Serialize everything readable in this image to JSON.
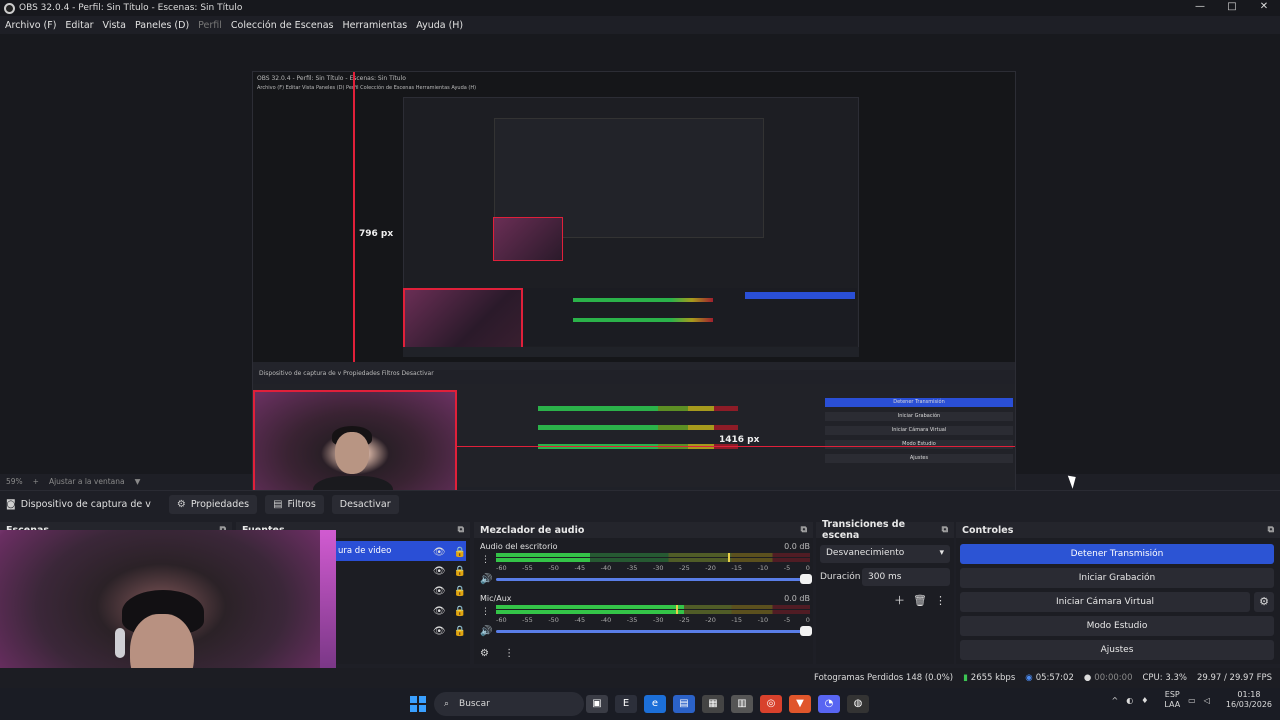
{
  "window": {
    "title": "OBS 32.0.4 - Perfil: Sin Título - Escenas: Sin Título",
    "controls": [
      "—",
      "□",
      "✕"
    ]
  },
  "menu": [
    "Archivo (F)",
    "Editar",
    "Vista",
    "Paneles (D)",
    "Perfil",
    "Colección de Escenas",
    "Herramientas",
    "Ayuda (H)"
  ],
  "preview": {
    "nested_title": "OBS 32.0.4 - Perfil: Sin Título - Escenas: Sin Título",
    "nested_menu": "Archivo (F)  Editar  Vista  Paneles (D)  Perfil  Colección de Escenas  Herramientas  Ayuda (H)",
    "height_label": "796 px",
    "width_label": "1416 px",
    "mini_toolbar": "Dispositivo de captura de v   Propiedades   Filtros   Desactivar",
    "mini_buttons": [
      "Detener Transmisión",
      "Iniciar Grabación",
      "Iniciar Cámara Virtual",
      "Modo Estudio",
      "Ajustes"
    ]
  },
  "zoom": {
    "level": "59%",
    "plus": "+",
    "fit": "Ajustar a la ventana",
    "dropdown": "▼"
  },
  "source_toolbar": {
    "source_name": "Dispositivo de captura de v",
    "properties": "Propiedades",
    "filters": "Filtros",
    "deactivate": "Desactivar"
  },
  "docks": {
    "scenes": "Escenas",
    "sources": "Fuentes",
    "mixer": "Mezclador de audio",
    "transitions": "Transiciones de escena",
    "controls": "Controles"
  },
  "sources_list": {
    "selected_label": "ura de video"
  },
  "mixer": {
    "tracks": [
      {
        "name": "Audio del escritorio",
        "db": "0.0 dB",
        "level": 0.3
      },
      {
        "name": "Mic/Aux",
        "db": "0.0 dB",
        "level": 0.6
      }
    ],
    "scale": [
      "-60",
      "-55",
      "-50",
      "-45",
      "-40",
      "-35",
      "-30",
      "-25",
      "-20",
      "-15",
      "-10",
      "-5",
      "0"
    ]
  },
  "transitions": {
    "selected": "Desvanecimiento",
    "duration_label": "Duración",
    "duration_value": "300 ms"
  },
  "controls": {
    "stop_stream": "Detener Transmisión",
    "start_record": "Iniciar Grabación",
    "virtual_cam": "Iniciar Cámara Virtual",
    "studio_mode": "Modo Estudio",
    "settings": "Ajustes"
  },
  "status": {
    "dropped_frames": "Fotogramas Perdidos 148 (0.0%)",
    "bitrate": "2655 kbps",
    "stream_time": "05:57:02",
    "record_time": "00:00:00",
    "cpu": "CPU: 3.3%",
    "fps": "29.97 / 29.97 FPS"
  },
  "taskbar": {
    "search": "Buscar",
    "lang_top": "ESP",
    "lang_bottom": "LAA",
    "time": "01:18",
    "date": "16/03/2026"
  },
  "colors": {
    "accent": "#2c54d4",
    "red_guide": "#e0203a",
    "meter_green": "#34c448"
  }
}
